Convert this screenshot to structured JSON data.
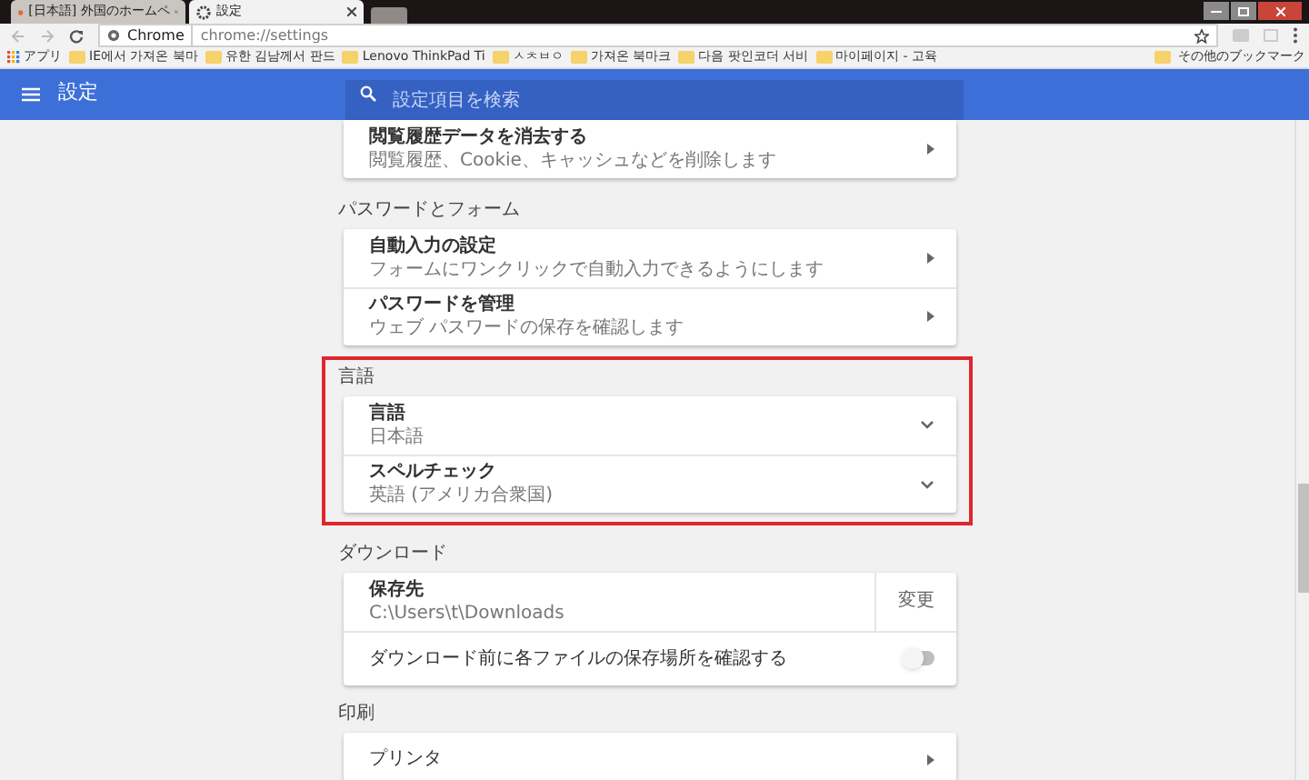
{
  "tabs": [
    {
      "label": "[日本語] 外国のホームペ",
      "selected": false
    },
    {
      "label": "設定",
      "selected": true
    }
  ],
  "address": {
    "site": "Chrome",
    "url": "chrome://settings"
  },
  "bookmarks": [
    "アプリ",
    "IE에서 가져온 북마",
    "유한 김남께서 판드",
    "Lenovo ThinkPad Ti",
    "ㅅㅊㅂㅇ",
    "가져온 북마크",
    "다음 팟인코더 서비",
    "마이페이지 - 고육"
  ],
  "other_bookmarks": "その他のブックマーク",
  "header": {
    "title": "設定",
    "search_placeholder": "設定項目を検索"
  },
  "sections": [
    {
      "rows": [
        {
          "kind": "arrow",
          "title": "閲覧履歴データを消去する",
          "subtitle": "閲覧履歴、Cookie、キャッシュなどを削除します"
        }
      ]
    },
    {
      "heading": "パスワードとフォーム",
      "rows": [
        {
          "kind": "arrow",
          "title": "自動入力の設定",
          "subtitle": "フォームにワンクリックで自動入力できるようにします"
        },
        {
          "kind": "arrow",
          "title": "パスワードを管理",
          "subtitle": "ウェブ パスワードの保存を確認します"
        }
      ]
    },
    {
      "heading": "言語",
      "highlighted": true,
      "rows": [
        {
          "kind": "expand",
          "title": "言語",
          "subtitle": "日本語"
        },
        {
          "kind": "expand",
          "title": "スペルチェック",
          "subtitle": "英語 (アメリカ合衆国)"
        }
      ]
    },
    {
      "heading": "ダウンロード",
      "rows": [
        {
          "kind": "button",
          "title": "保存先",
          "subtitle": "C:\\Users\\t\\Downloads",
          "action": "変更"
        },
        {
          "kind": "toggle",
          "title": "ダウンロード前に各ファイルの保存場所を確認する",
          "on": false
        }
      ]
    },
    {
      "heading": "印刷",
      "rows": [
        {
          "kind": "arrow",
          "title": "プリンタ"
        }
      ]
    }
  ]
}
